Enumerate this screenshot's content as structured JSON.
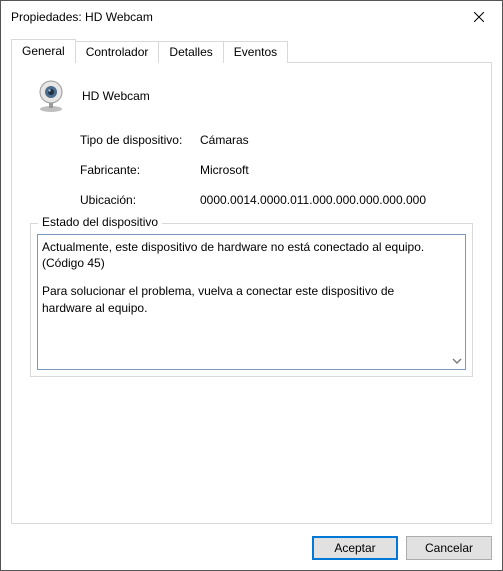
{
  "window": {
    "title": "Propiedades: HD Webcam"
  },
  "tabs": {
    "general": "General",
    "driver": "Controlador",
    "details": "Detalles",
    "events": "Eventos"
  },
  "device": {
    "name": "HD Webcam",
    "type_label": "Tipo de dispositivo:",
    "type_value": "Cámaras",
    "manufacturer_label": "Fabricante:",
    "manufacturer_value": "Microsoft",
    "location_label": "Ubicación:",
    "location_value": "0000.0014.0000.011.000.000.000.000.000"
  },
  "status": {
    "group_label": "Estado del dispositivo",
    "line1": "Actualmente, este dispositivo de hardware no está conectado al equipo. (Código 45)",
    "line2": "Para solucionar el problema, vuelva a conectar este dispositivo de hardware al equipo."
  },
  "buttons": {
    "ok": "Aceptar",
    "cancel": "Cancelar"
  }
}
